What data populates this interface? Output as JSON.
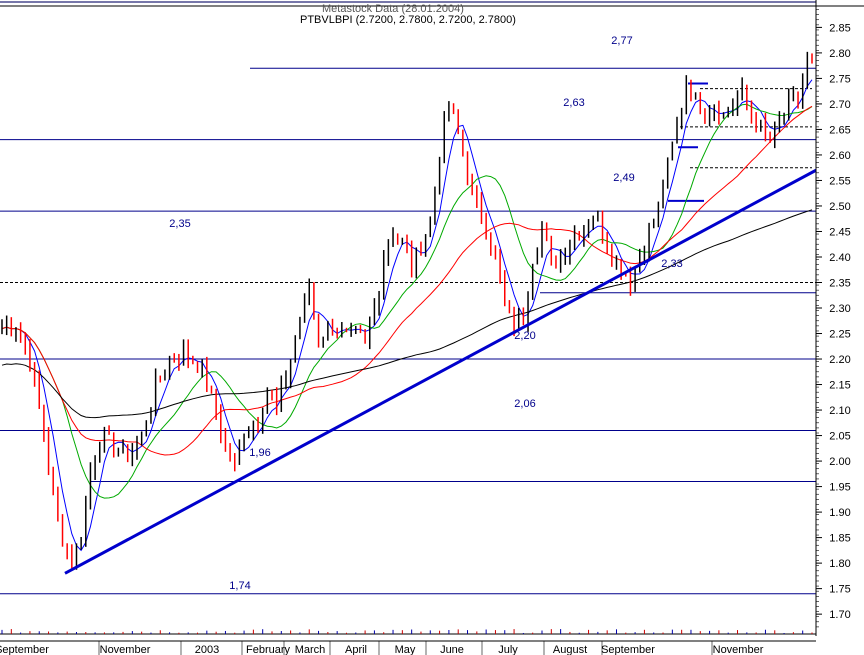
{
  "header": {
    "ghost_text": "Metastock Data (28.01.2004)",
    "title_line": "PTBVLBPI (2.7200, 2.7800, 2.7200, 2.7800)"
  },
  "colors": {
    "price_bar_up": "#000000",
    "price_bar_down": "#ff0000",
    "trendline": "#0000cc",
    "horizontal_level": "#00008b",
    "ma_fast": "#0000ff",
    "ma_green": "#00aa00",
    "ma_red": "#ff0000",
    "ma_slow": "#000000"
  },
  "chart_data": {
    "type": "line",
    "title": "PTBVLBPI",
    "ohlc_last": {
      "open": 2.72,
      "high": 2.78,
      "low": 2.72,
      "close": 2.78
    },
    "x_axis_labels": [
      "September",
      "November",
      "2003",
      "February",
      "March",
      "April",
      "May",
      "June",
      "July",
      "August",
      "September",
      "November"
    ],
    "y_ticks": [
      2.85,
      2.8,
      2.75,
      2.7,
      2.65,
      2.6,
      2.55,
      2.5,
      2.45,
      2.4,
      2.35,
      2.3,
      2.25,
      2.2,
      2.15,
      2.1,
      2.05,
      2.0,
      1.95,
      1.9,
      1.85,
      1.8,
      1.75,
      1.7
    ],
    "y_tick_labels": [
      "2.85",
      "2.80",
      "2.75",
      "2.70",
      "2.65",
      "2.60",
      "2.55",
      "2.50",
      "2.45",
      "2.40",
      "2.35",
      "2.30",
      "2.25",
      "2.20",
      "2.15",
      "2.10",
      "2.05",
      "2.00",
      "1.95",
      "1.90",
      "1.85",
      "1.80",
      "1.75",
      "1.70"
    ],
    "ylim": [
      1.665,
      2.888
    ],
    "levels": [
      {
        "value": 2.77,
        "label": "2,77",
        "style": "solid"
      },
      {
        "value": 2.63,
        "label": "2,63",
        "style": "solid"
      },
      {
        "value": 2.49,
        "label": "2,49",
        "style": "solid"
      },
      {
        "value": 2.35,
        "label": "2,35",
        "style": "dashed"
      },
      {
        "value": 2.33,
        "label": "2,33",
        "style": "solid"
      },
      {
        "value": 2.2,
        "label": "2,20",
        "style": "solid"
      },
      {
        "value": 2.06,
        "label": "2,06",
        "style": "solid"
      },
      {
        "value": 1.96,
        "label": "1,96",
        "style": "solid"
      },
      {
        "value": 1.74,
        "label": "1,74",
        "style": "solid"
      }
    ],
    "trendline": {
      "from": [
        "late October 2002",
        1.78
      ],
      "to": [
        "end of chart",
        2.57
      ]
    },
    "price_path": [
      [
        0,
        2.26
      ],
      [
        3,
        2.27
      ],
      [
        6,
        2.2
      ],
      [
        9,
        2.05
      ],
      [
        12,
        1.88
      ],
      [
        15,
        1.8
      ],
      [
        17,
        1.85
      ],
      [
        19,
        1.98
      ],
      [
        21,
        2.05
      ],
      [
        24,
        2.03
      ],
      [
        27,
        2.01
      ],
      [
        30,
        2.05
      ],
      [
        33,
        2.15
      ],
      [
        36,
        2.2
      ],
      [
        39,
        2.21
      ],
      [
        42,
        2.19
      ],
      [
        44,
        2.15
      ],
      [
        46,
        2.1
      ],
      [
        48,
        2.02
      ],
      [
        50,
        1.99
      ],
      [
        52,
        2.06
      ],
      [
        55,
        2.08
      ],
      [
        57,
        2.14
      ],
      [
        59,
        2.1
      ],
      [
        62,
        2.2
      ],
      [
        64,
        2.28
      ],
      [
        66,
        2.34
      ],
      [
        68,
        2.24
      ],
      [
        71,
        2.27
      ],
      [
        74,
        2.24
      ],
      [
        76,
        2.25
      ],
      [
        78,
        2.23
      ],
      [
        80,
        2.3
      ],
      [
        82,
        2.4
      ],
      [
        84,
        2.45
      ],
      [
        86,
        2.43
      ],
      [
        88,
        2.38
      ],
      [
        90,
        2.42
      ],
      [
        92,
        2.47
      ],
      [
        94,
        2.6
      ],
      [
        96,
        2.7
      ],
      [
        98,
        2.64
      ],
      [
        99,
        2.6
      ],
      [
        101,
        2.52
      ],
      [
        104,
        2.46
      ],
      [
        106,
        2.4
      ],
      [
        108,
        2.3
      ],
      [
        110,
        2.27
      ],
      [
        112,
        2.28
      ],
      [
        114,
        2.4
      ],
      [
        116,
        2.46
      ],
      [
        118,
        2.38
      ],
      [
        120,
        2.4
      ],
      [
        122,
        2.44
      ],
      [
        125,
        2.46
      ],
      [
        127,
        2.48
      ],
      [
        129,
        2.45
      ],
      [
        131,
        2.4
      ],
      [
        133,
        2.38
      ],
      [
        135,
        2.35
      ],
      [
        137,
        2.4
      ],
      [
        139,
        2.45
      ],
      [
        141,
        2.5
      ],
      [
        143,
        2.58
      ],
      [
        145,
        2.65
      ],
      [
        147,
        2.75
      ],
      [
        149,
        2.7
      ],
      [
        151,
        2.69
      ],
      [
        153,
        2.7
      ],
      [
        155,
        2.68
      ],
      [
        157,
        2.7
      ],
      [
        159,
        2.72
      ],
      [
        161,
        2.68
      ],
      [
        163,
        2.65
      ],
      [
        165,
        2.63
      ],
      [
        167,
        2.66
      ],
      [
        169,
        2.7
      ],
      [
        171,
        2.71
      ],
      [
        173,
        2.78
      ]
    ],
    "moving_averages": [
      {
        "color": "#0000ff",
        "period": 5
      },
      {
        "color": "#00aa00",
        "period": 14
      },
      {
        "color": "#ff0000",
        "period": 30
      },
      {
        "color": "#000000",
        "period": 90
      }
    ],
    "grid": false,
    "legend": "none"
  }
}
